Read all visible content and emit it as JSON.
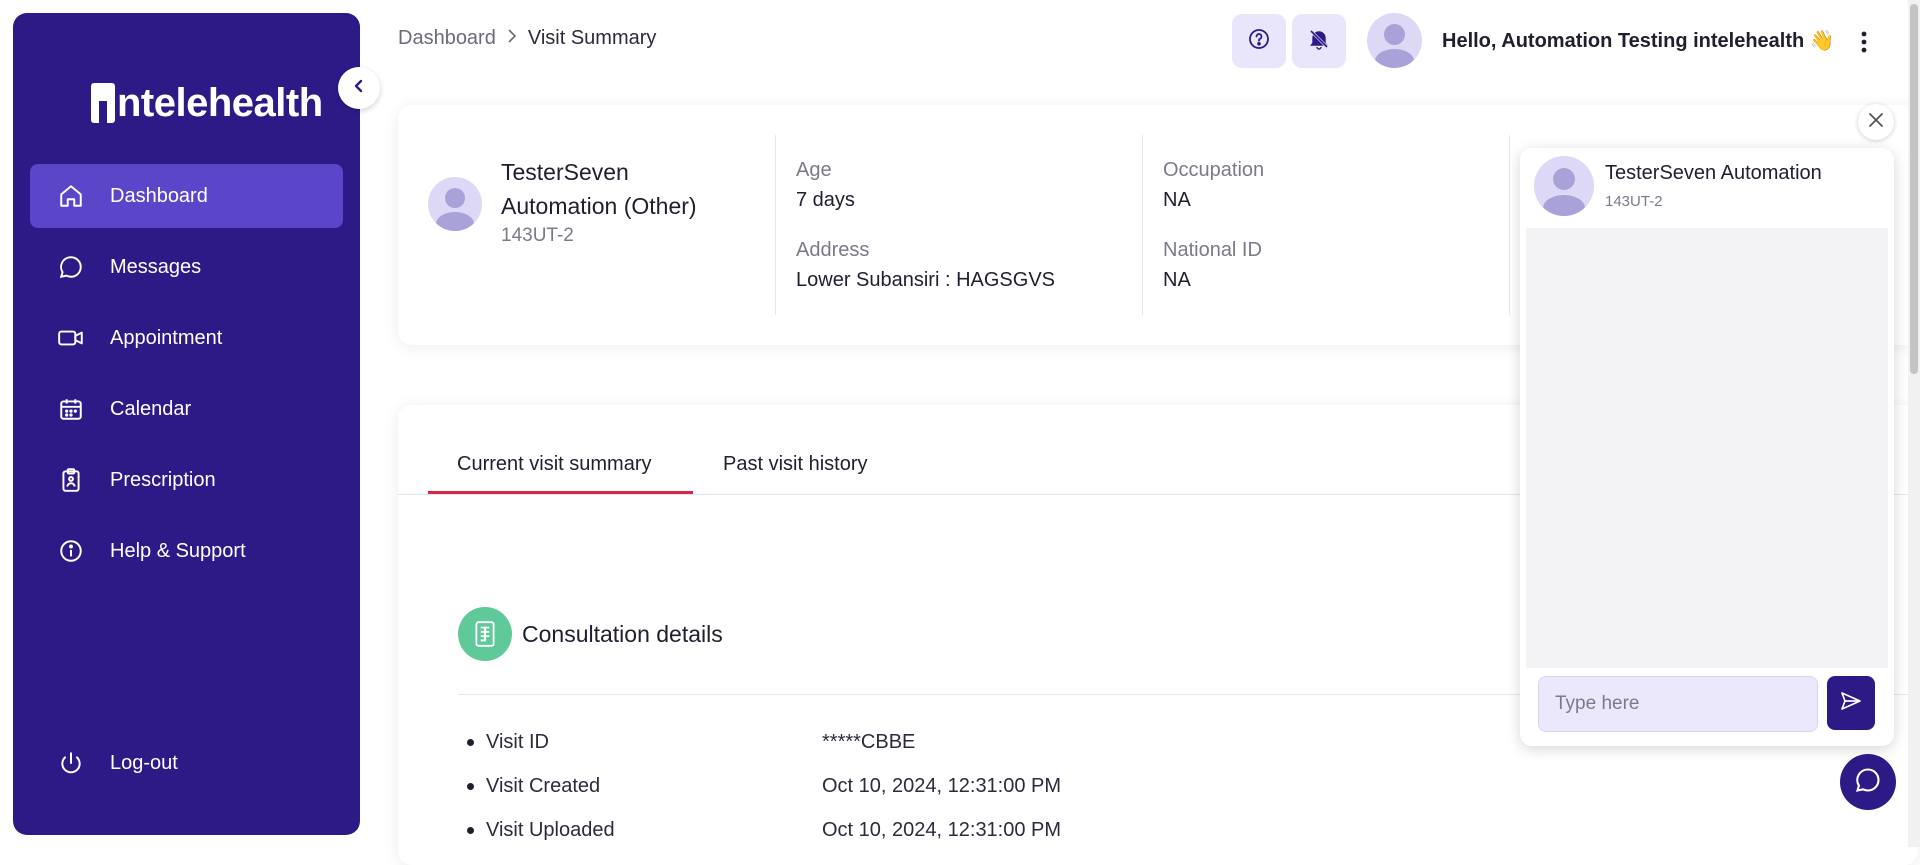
{
  "app": {
    "logo_text": "intelehealth"
  },
  "sidebar": {
    "items": [
      {
        "label": "Dashboard",
        "icon": "home-icon",
        "active": true
      },
      {
        "label": "Messages",
        "icon": "message-icon",
        "active": false
      },
      {
        "label": "Appointment",
        "icon": "video-icon",
        "active": false
      },
      {
        "label": "Calendar",
        "icon": "calendar-icon",
        "active": false
      },
      {
        "label": "Prescription",
        "icon": "prescription-icon",
        "active": false
      },
      {
        "label": "Help & Support",
        "icon": "info-icon",
        "active": false
      }
    ],
    "logout_label": "Log-out"
  },
  "header": {
    "breadcrumb": [
      "Dashboard",
      "Visit Summary"
    ],
    "greeting": "Hello, Automation Testing intelehealth 👋"
  },
  "patient": {
    "name": "TesterSeven Automation (Other)",
    "id": "143UT-2",
    "fields": [
      {
        "label": "Age",
        "value": "7 days"
      },
      {
        "label": "Address",
        "value": "Lower Subansiri : HAGSGVS"
      },
      {
        "label": "Occupation",
        "value": "NA"
      },
      {
        "label": "National ID",
        "value": "NA"
      }
    ]
  },
  "tabs": [
    {
      "label": "Current visit summary",
      "active": true
    },
    {
      "label": "Past visit history",
      "active": false
    }
  ],
  "consultation": {
    "title": "Consultation details",
    "rows": [
      {
        "label": "Visit ID",
        "value": "*****CBBE"
      },
      {
        "label": "Visit Created",
        "value": "Oct 10, 2024, 12:31:00 PM"
      },
      {
        "label": "Visit Uploaded",
        "value": "Oct 10, 2024, 12:31:00 PM"
      }
    ]
  },
  "chat": {
    "name": "TesterSeven Automation",
    "id": "143UT-2",
    "placeholder": "Type here"
  },
  "colors": {
    "sidebar_bg": "#2e1a87",
    "sidebar_active": "#5b46c9",
    "accent_underline": "#d8264b",
    "consult_icon_bg": "#5fc99a"
  }
}
